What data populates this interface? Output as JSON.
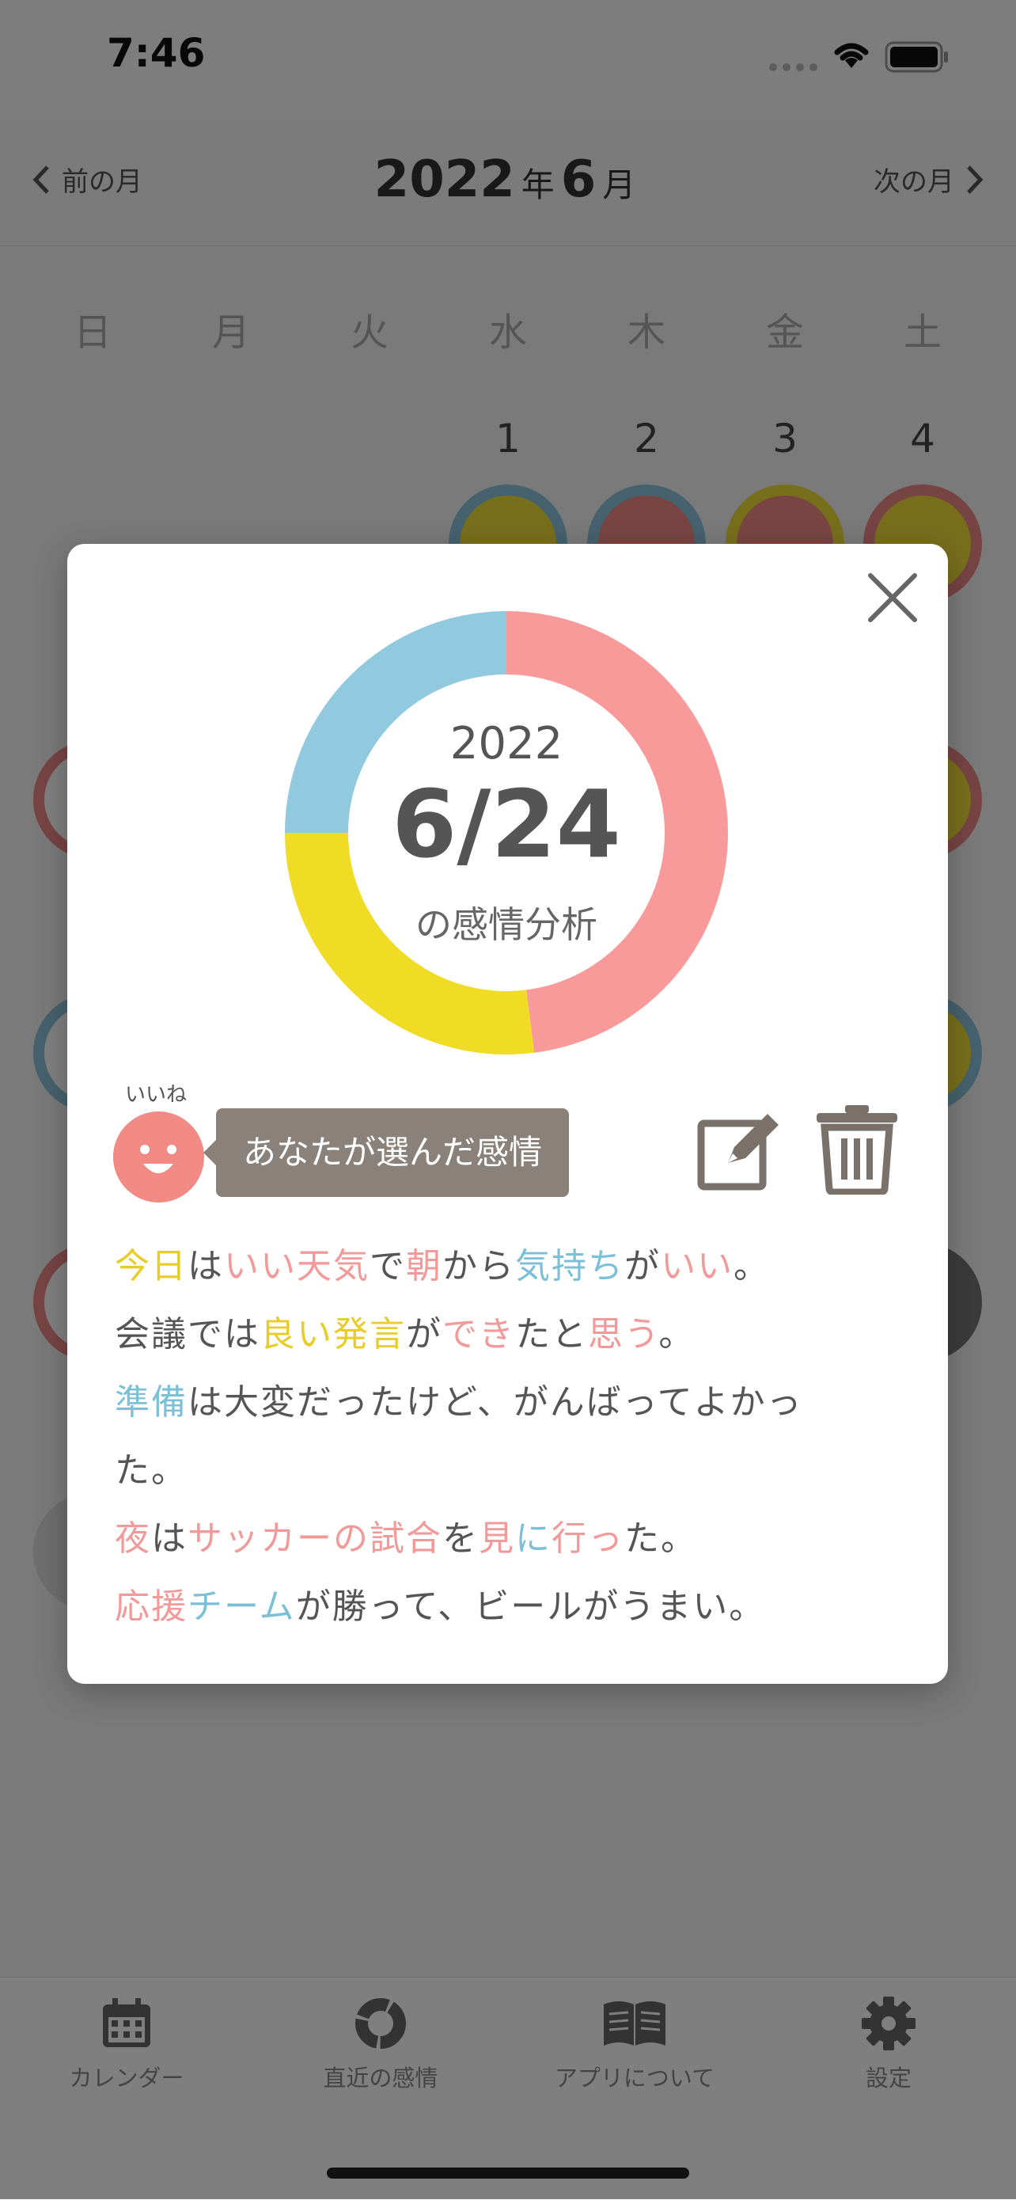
{
  "status": {
    "time": "7:46"
  },
  "header": {
    "prev_label": "前の月",
    "next_label": "次の月",
    "year": "2022",
    "year_unit": "年",
    "month": "6",
    "month_unit": "月"
  },
  "weekdays": [
    "日",
    "月",
    "火",
    "水",
    "木",
    "金",
    "土"
  ],
  "days": [
    "1",
    "2",
    "3",
    "4"
  ],
  "modal": {
    "year": "2022",
    "date": "6/24",
    "caption": "の感情分析",
    "emotion_small_label": "いいね",
    "emotion_tooltip": "あなたが選んだ感情",
    "chart_data": {
      "type": "pie",
      "slices": [
        {
          "color": "#f99a9a",
          "value": 48
        },
        {
          "color": "#f0dc24",
          "value": 27
        },
        {
          "color": "#91cadf",
          "value": 25
        }
      ]
    },
    "diary": {
      "l1": [
        "今日",
        "は",
        "いい天気",
        "で",
        "朝",
        "から",
        "気持ち",
        "が",
        "いい",
        "。"
      ],
      "l2": [
        "会議では",
        "良い発言",
        "が",
        "でき",
        "たと",
        "思う",
        "。"
      ],
      "l3": [
        "準備",
        "は大変だったけど、がんばってよかっ"
      ],
      "l4": [
        "た。"
      ],
      "l5": [
        "夜",
        "は",
        "サッカーの試合",
        "を",
        "見",
        "に",
        "行っ",
        "た。"
      ],
      "l6": [
        "応援",
        "チーム",
        "が勝って、ビールがうまい。"
      ]
    }
  },
  "tabs": [
    "カレンダー",
    "直近の感情",
    "アプリについて",
    "設定"
  ]
}
